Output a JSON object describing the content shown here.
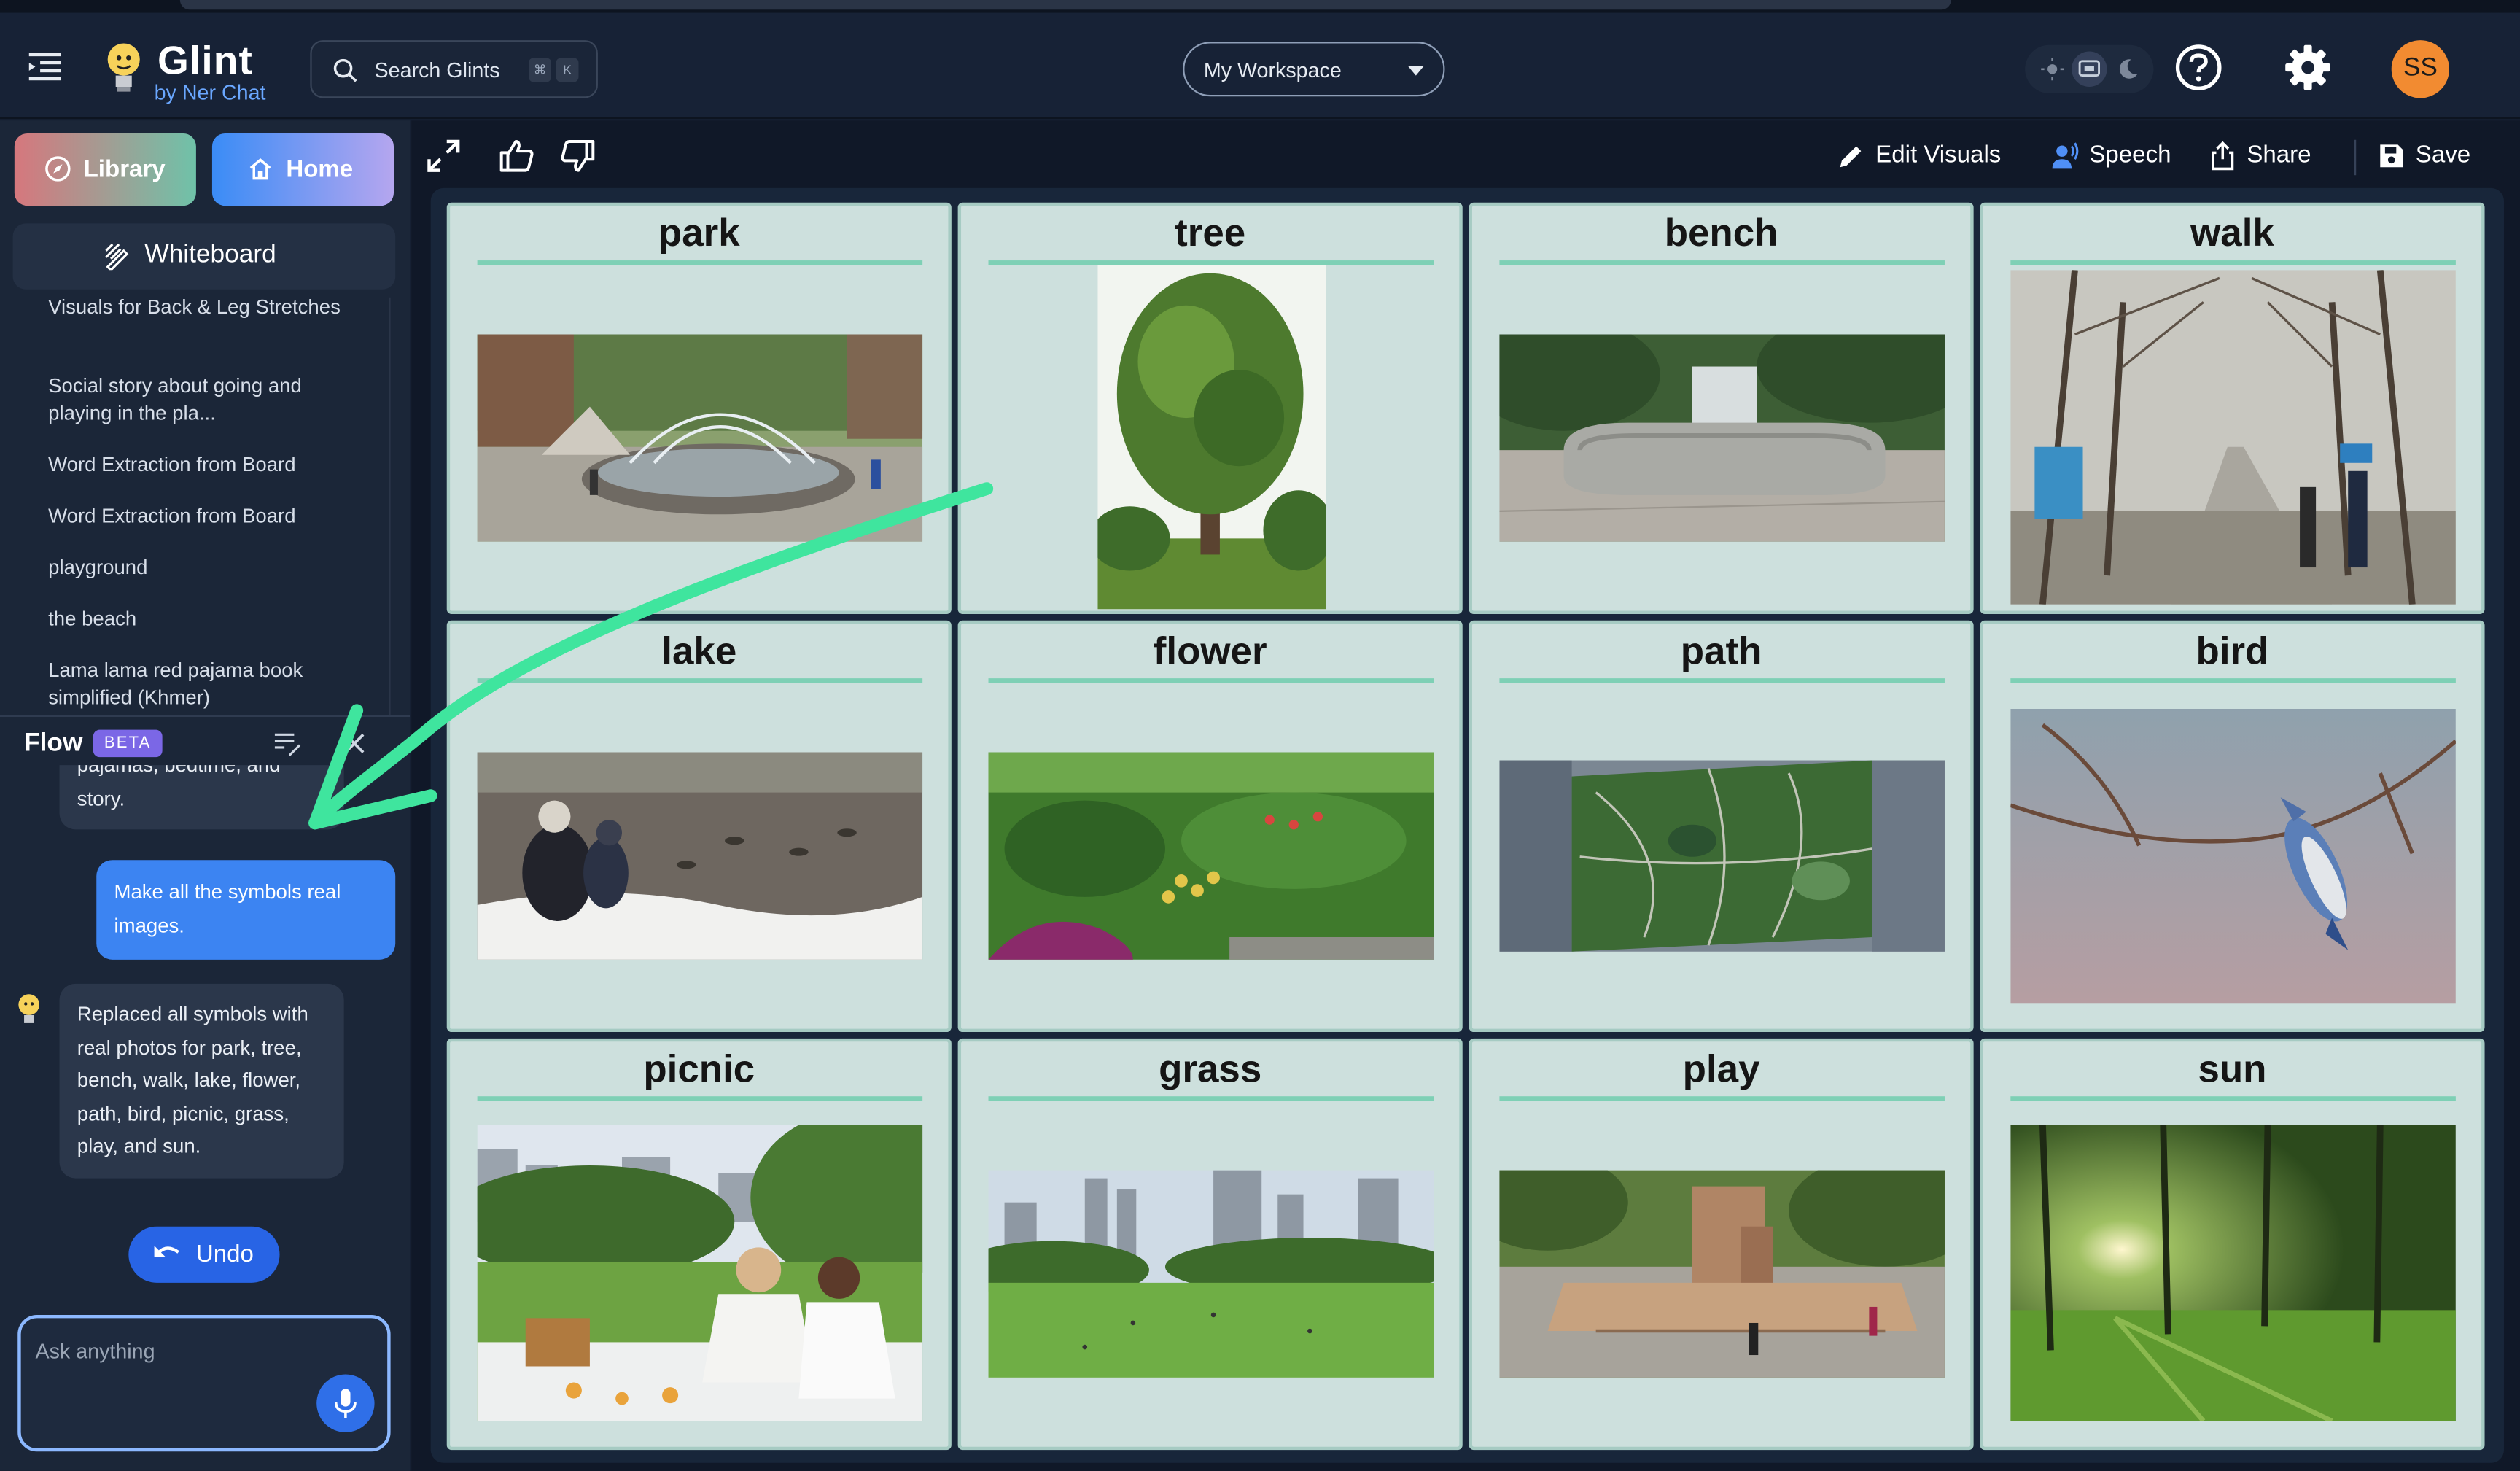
{
  "app": {
    "name": "Glint",
    "byline": "by Ner Chat",
    "search_placeholder": "Search Glints",
    "shortcut_keys": [
      "⌘",
      "K"
    ],
    "workspace": "My Workspace",
    "avatar_initials": "SS",
    "accent_color": "#3c84f2",
    "avatar_color": "#f28b31"
  },
  "sidebar": {
    "library_label": "Library",
    "home_label": "Home",
    "whiteboard_label": "Whiteboard",
    "history": [
      "Visuals for Back & Leg Stretches",
      "Social story about going and playing in the pla...",
      "Word Extraction from Board",
      "Word Extraction from Board",
      "playground",
      "the beach",
      "Lama lama red pajama book simplified (Khmer)"
    ]
  },
  "flow": {
    "title": "Flow",
    "badge": "BETA",
    "messages": [
      {
        "role": "assistant",
        "text": "pajamas, bedtime, and story."
      },
      {
        "role": "user",
        "text": "Make all the symbols real images."
      },
      {
        "role": "assistant",
        "text": "Replaced all symbols with real photos for park, tree, bench, walk, lake, flower, path, bird, picnic, grass, play, and sun."
      }
    ],
    "undo_label": "Undo",
    "input_placeholder": "Ask anything"
  },
  "toolbar": {
    "edit_visuals": "Edit Visuals",
    "speech": "Speech",
    "share": "Share",
    "save": "Save"
  },
  "board": {
    "cards": [
      {
        "word": "park",
        "image": "park-fountain-photo"
      },
      {
        "word": "tree",
        "image": "tree-photo"
      },
      {
        "word": "bench",
        "image": "stone-bench-photo"
      },
      {
        "word": "walk",
        "image": "tree-lined-walkway-photo"
      },
      {
        "word": "lake",
        "image": "lake-with-ducks-photo"
      },
      {
        "word": "flower",
        "image": "flower-garden-photo"
      },
      {
        "word": "path",
        "image": "aerial-park-paths-photo"
      },
      {
        "word": "bird",
        "image": "blue-jay-on-branch-photo"
      },
      {
        "word": "picnic",
        "image": "couple-picnic-photo"
      },
      {
        "word": "grass",
        "image": "lawn-city-skyline-photo"
      },
      {
        "word": "play",
        "image": "playground-photo"
      },
      {
        "word": "sun",
        "image": "sunlit-trees-photo"
      }
    ]
  }
}
